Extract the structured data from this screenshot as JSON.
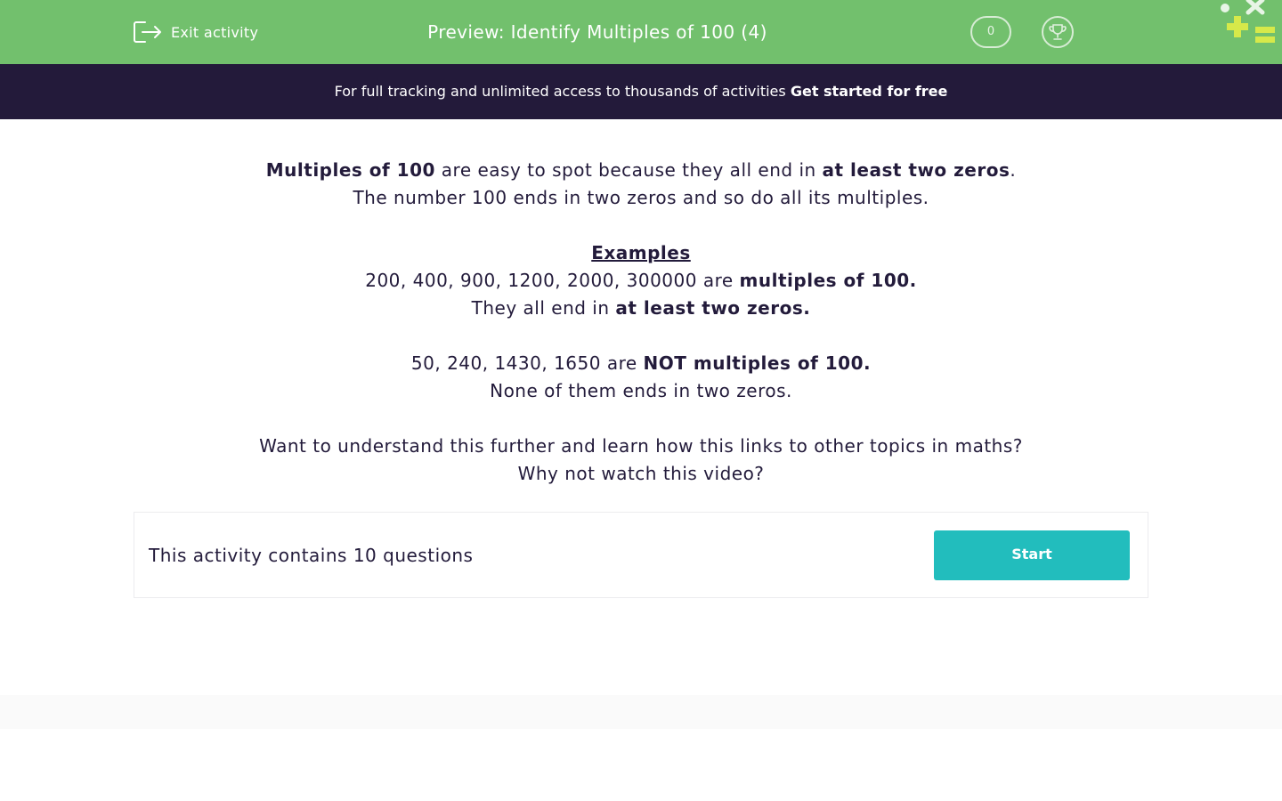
{
  "header": {
    "exit_label": "Exit activity",
    "exit_icon": "exit-icon",
    "title": "Preview: Identify Multiples of 100 (4)",
    "score": "0",
    "trophy_icon": "trophy-icon",
    "accent_color": "#72c06d"
  },
  "promo": {
    "text": "For full tracking and unlimited access to thousands of activities ",
    "cta": "Get started for free",
    "background": "#231a3a"
  },
  "intro": {
    "line1_bold_a": "Multiples of 100",
    "line1_text": " are easy to spot because they all end in ",
    "line1_bold_b": "at least two zeros",
    "line1_end": ".",
    "line2": "The number 100 ends in two zeros and so do all its multiples.",
    "examples_heading": "Examples",
    "ex1_text": "200, 400, 900, 1200, 2000, 300000 are ",
    "ex1_bold": "multiples of 100.",
    "ex2_text": "They all end in ",
    "ex2_bold": "at least two zeros.",
    "ex3_text": "50, 240, 1430, 1650 are ",
    "ex3_bold": "NOT multiples of 100.",
    "ex4": "None of them ends in two zeros.",
    "further1": "Want to understand this further and learn how this links to other topics in maths?",
    "further2": "Why not watch this video?"
  },
  "activity": {
    "question_count_text": "This activity contains 10 questions",
    "start_label": "Start",
    "start_color": "#22bdbd"
  }
}
